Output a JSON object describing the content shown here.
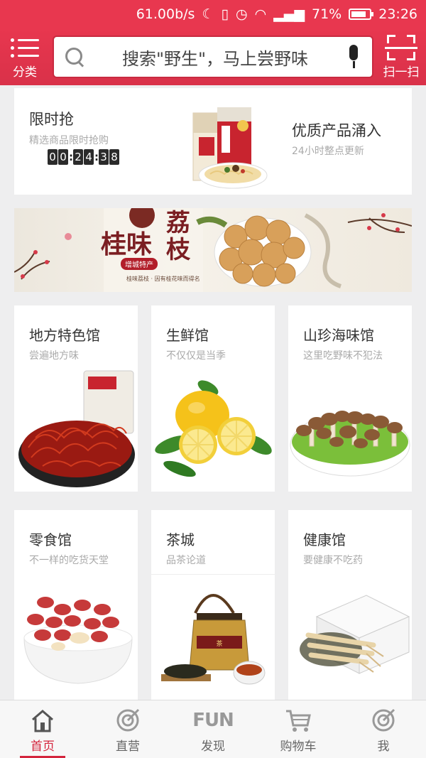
{
  "status_bar": {
    "speed": "61.00b/s",
    "battery": "71%",
    "time": "23:26"
  },
  "header": {
    "category_label": "分类",
    "search_placeholder": "搜索\"野生\"，马上尝野味",
    "scan_label": "扫一扫"
  },
  "flash_sale": {
    "title": "限时抢",
    "subtitle": "精选商品限时抢购",
    "timer_digits": [
      "0",
      "0",
      "2",
      "4",
      "3",
      "8"
    ],
    "promo_title": "优质产品涌入",
    "promo_subtitle": "24小时整点更新"
  },
  "banner": {
    "title_left": "桂味",
    "title_right": "荔枝",
    "tag": "增城特产",
    "caption": "桂味荔枝 · 因有桂花味而得名"
  },
  "categories": [
    {
      "title": "地方特色馆",
      "subtitle": "尝遍地方味"
    },
    {
      "title": "生鲜馆",
      "subtitle": "不仅仅是当季"
    },
    {
      "title": "山珍海味馆",
      "subtitle": "这里吃野味不犯法"
    },
    {
      "title": "零食馆",
      "subtitle": "不一样的吃货天堂"
    },
    {
      "title": "茶城",
      "subtitle": "品茶论道"
    },
    {
      "title": "健康馆",
      "subtitle": "要健康不吃药"
    }
  ],
  "bottom_nav": [
    {
      "label": "首页",
      "icon": "home-icon",
      "active": true
    },
    {
      "label": "直营",
      "icon": "target-icon",
      "active": false
    },
    {
      "label": "发现",
      "icon": "fun-icon",
      "active": false
    },
    {
      "label": "购物车",
      "icon": "cart-icon",
      "active": false
    },
    {
      "label": "我",
      "icon": "target-icon",
      "active": false
    }
  ],
  "colors": {
    "brand_red": "#e8374f",
    "active_red": "#d4253d"
  }
}
